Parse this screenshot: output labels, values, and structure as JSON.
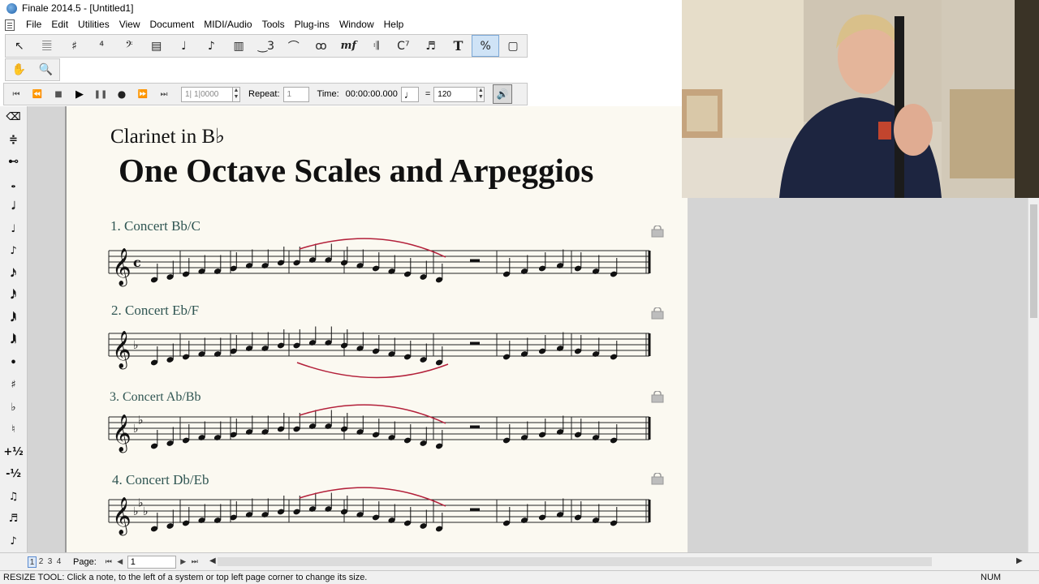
{
  "window": {
    "title": "Finale 2014.5 - [Untitled1]"
  },
  "menu": [
    "File",
    "Edit",
    "Utilities",
    "View",
    "Document",
    "MIDI/Audio",
    "Tools",
    "Plug-ins",
    "Window",
    "Help"
  ],
  "main_tools": [
    {
      "name": "selection-tool",
      "glyph": "↖"
    },
    {
      "name": "staff-tool",
      "glyph": "𝄚"
    },
    {
      "name": "key-signature-tool",
      "glyph": "♯"
    },
    {
      "name": "time-signature-tool",
      "glyph": "⁴"
    },
    {
      "name": "clef-tool",
      "glyph": "𝄢"
    },
    {
      "name": "measure-tool",
      "glyph": "▤"
    },
    {
      "name": "simple-entry-tool",
      "glyph": "♩"
    },
    {
      "name": "speedy-entry-tool",
      "glyph": "♪"
    },
    {
      "name": "layer-tool",
      "glyph": "▥"
    },
    {
      "name": "tuplet-tool",
      "glyph": "‿3"
    },
    {
      "name": "smart-shape-tool",
      "glyph": "⌒"
    },
    {
      "name": "articulation-tool",
      "glyph": "ꝏ"
    },
    {
      "name": "expression-tool",
      "glyph": "mf"
    },
    {
      "name": "repeat-tool",
      "glyph": "𝄇"
    },
    {
      "name": "chord-tool",
      "glyph": "C⁷"
    },
    {
      "name": "lyrics-tool",
      "glyph": "♬"
    },
    {
      "name": "text-tool",
      "glyph": "T"
    },
    {
      "name": "resize-tool",
      "glyph": "%"
    },
    {
      "name": "page-layout-tool",
      "glyph": "▢"
    }
  ],
  "view_tools": [
    {
      "name": "hand-grabber-tool",
      "glyph": "✋"
    },
    {
      "name": "zoom-tool",
      "glyph": "🔍"
    }
  ],
  "playback": {
    "measure_field": "1| 1|0000",
    "repeat_label": "Repeat:",
    "repeat_value": "1",
    "time_label": "Time:",
    "time_value": "00:00:00.000",
    "tempo_equals": "=",
    "tempo_value": "120"
  },
  "side_tools": [
    {
      "name": "eraser-icon",
      "glyph": "⌫"
    },
    {
      "name": "ledger-icon",
      "glyph": "≑"
    },
    {
      "name": "dynamics-icon",
      "glyph": "⊷"
    },
    {
      "name": "whole-note-icon",
      "glyph": "𝅝"
    },
    {
      "name": "half-note-icon",
      "glyph": "𝅗𝅥"
    },
    {
      "name": "quarter-note-icon",
      "glyph": "♩"
    },
    {
      "name": "eighth-note-icon",
      "glyph": "♪"
    },
    {
      "name": "sixteenth-note-icon",
      "glyph": "𝅘𝅥𝅯"
    },
    {
      "name": "thirty-second-note-icon",
      "glyph": "𝅘𝅥𝅰"
    },
    {
      "name": "sixty-fourth-note-icon",
      "glyph": "𝅘𝅥𝅱"
    },
    {
      "name": "hundred-twenty-eighth-note-icon",
      "glyph": "𝅘𝅥𝅲"
    },
    {
      "name": "dot-icon",
      "glyph": "•"
    },
    {
      "name": "sharp-icon",
      "glyph": "♯"
    },
    {
      "name": "flat-icon",
      "glyph": "♭"
    },
    {
      "name": "natural-icon",
      "glyph": "♮"
    },
    {
      "name": "half-step-up-icon",
      "glyph": "+½"
    },
    {
      "name": "half-step-down-icon",
      "glyph": "-½"
    },
    {
      "name": "tie-icon",
      "glyph": "♫"
    },
    {
      "name": "tuplet-icon",
      "glyph": "♬"
    },
    {
      "name": "grace-note-icon",
      "glyph": "♪"
    }
  ],
  "score": {
    "subtitle": "Clarinet in B♭",
    "title": "One Octave Scales and Arpeggios",
    "systems": [
      {
        "label": "1.  Concert Bb/C",
        "key_flats": 0
      },
      {
        "label": "2.  Concert Eb/F",
        "key_flats": 1
      },
      {
        "label": "3.  Concert Ab/Bb",
        "key_flats": 2
      },
      {
        "label": "4.  Concert Db/Eb",
        "key_flats": 3
      }
    ]
  },
  "page_nav": {
    "pages": [
      "1",
      "2",
      "3",
      "4"
    ],
    "label": "Page:",
    "current": "1"
  },
  "status": {
    "message": "RESIZE TOOL: Click a note, to the left of a system or top left page corner to change its size.",
    "num": "NUM"
  },
  "colors": {
    "slur": "#b3203a",
    "label": "#2f5552",
    "page": "#fbf9f1",
    "canvas": "#d4d4d4"
  }
}
